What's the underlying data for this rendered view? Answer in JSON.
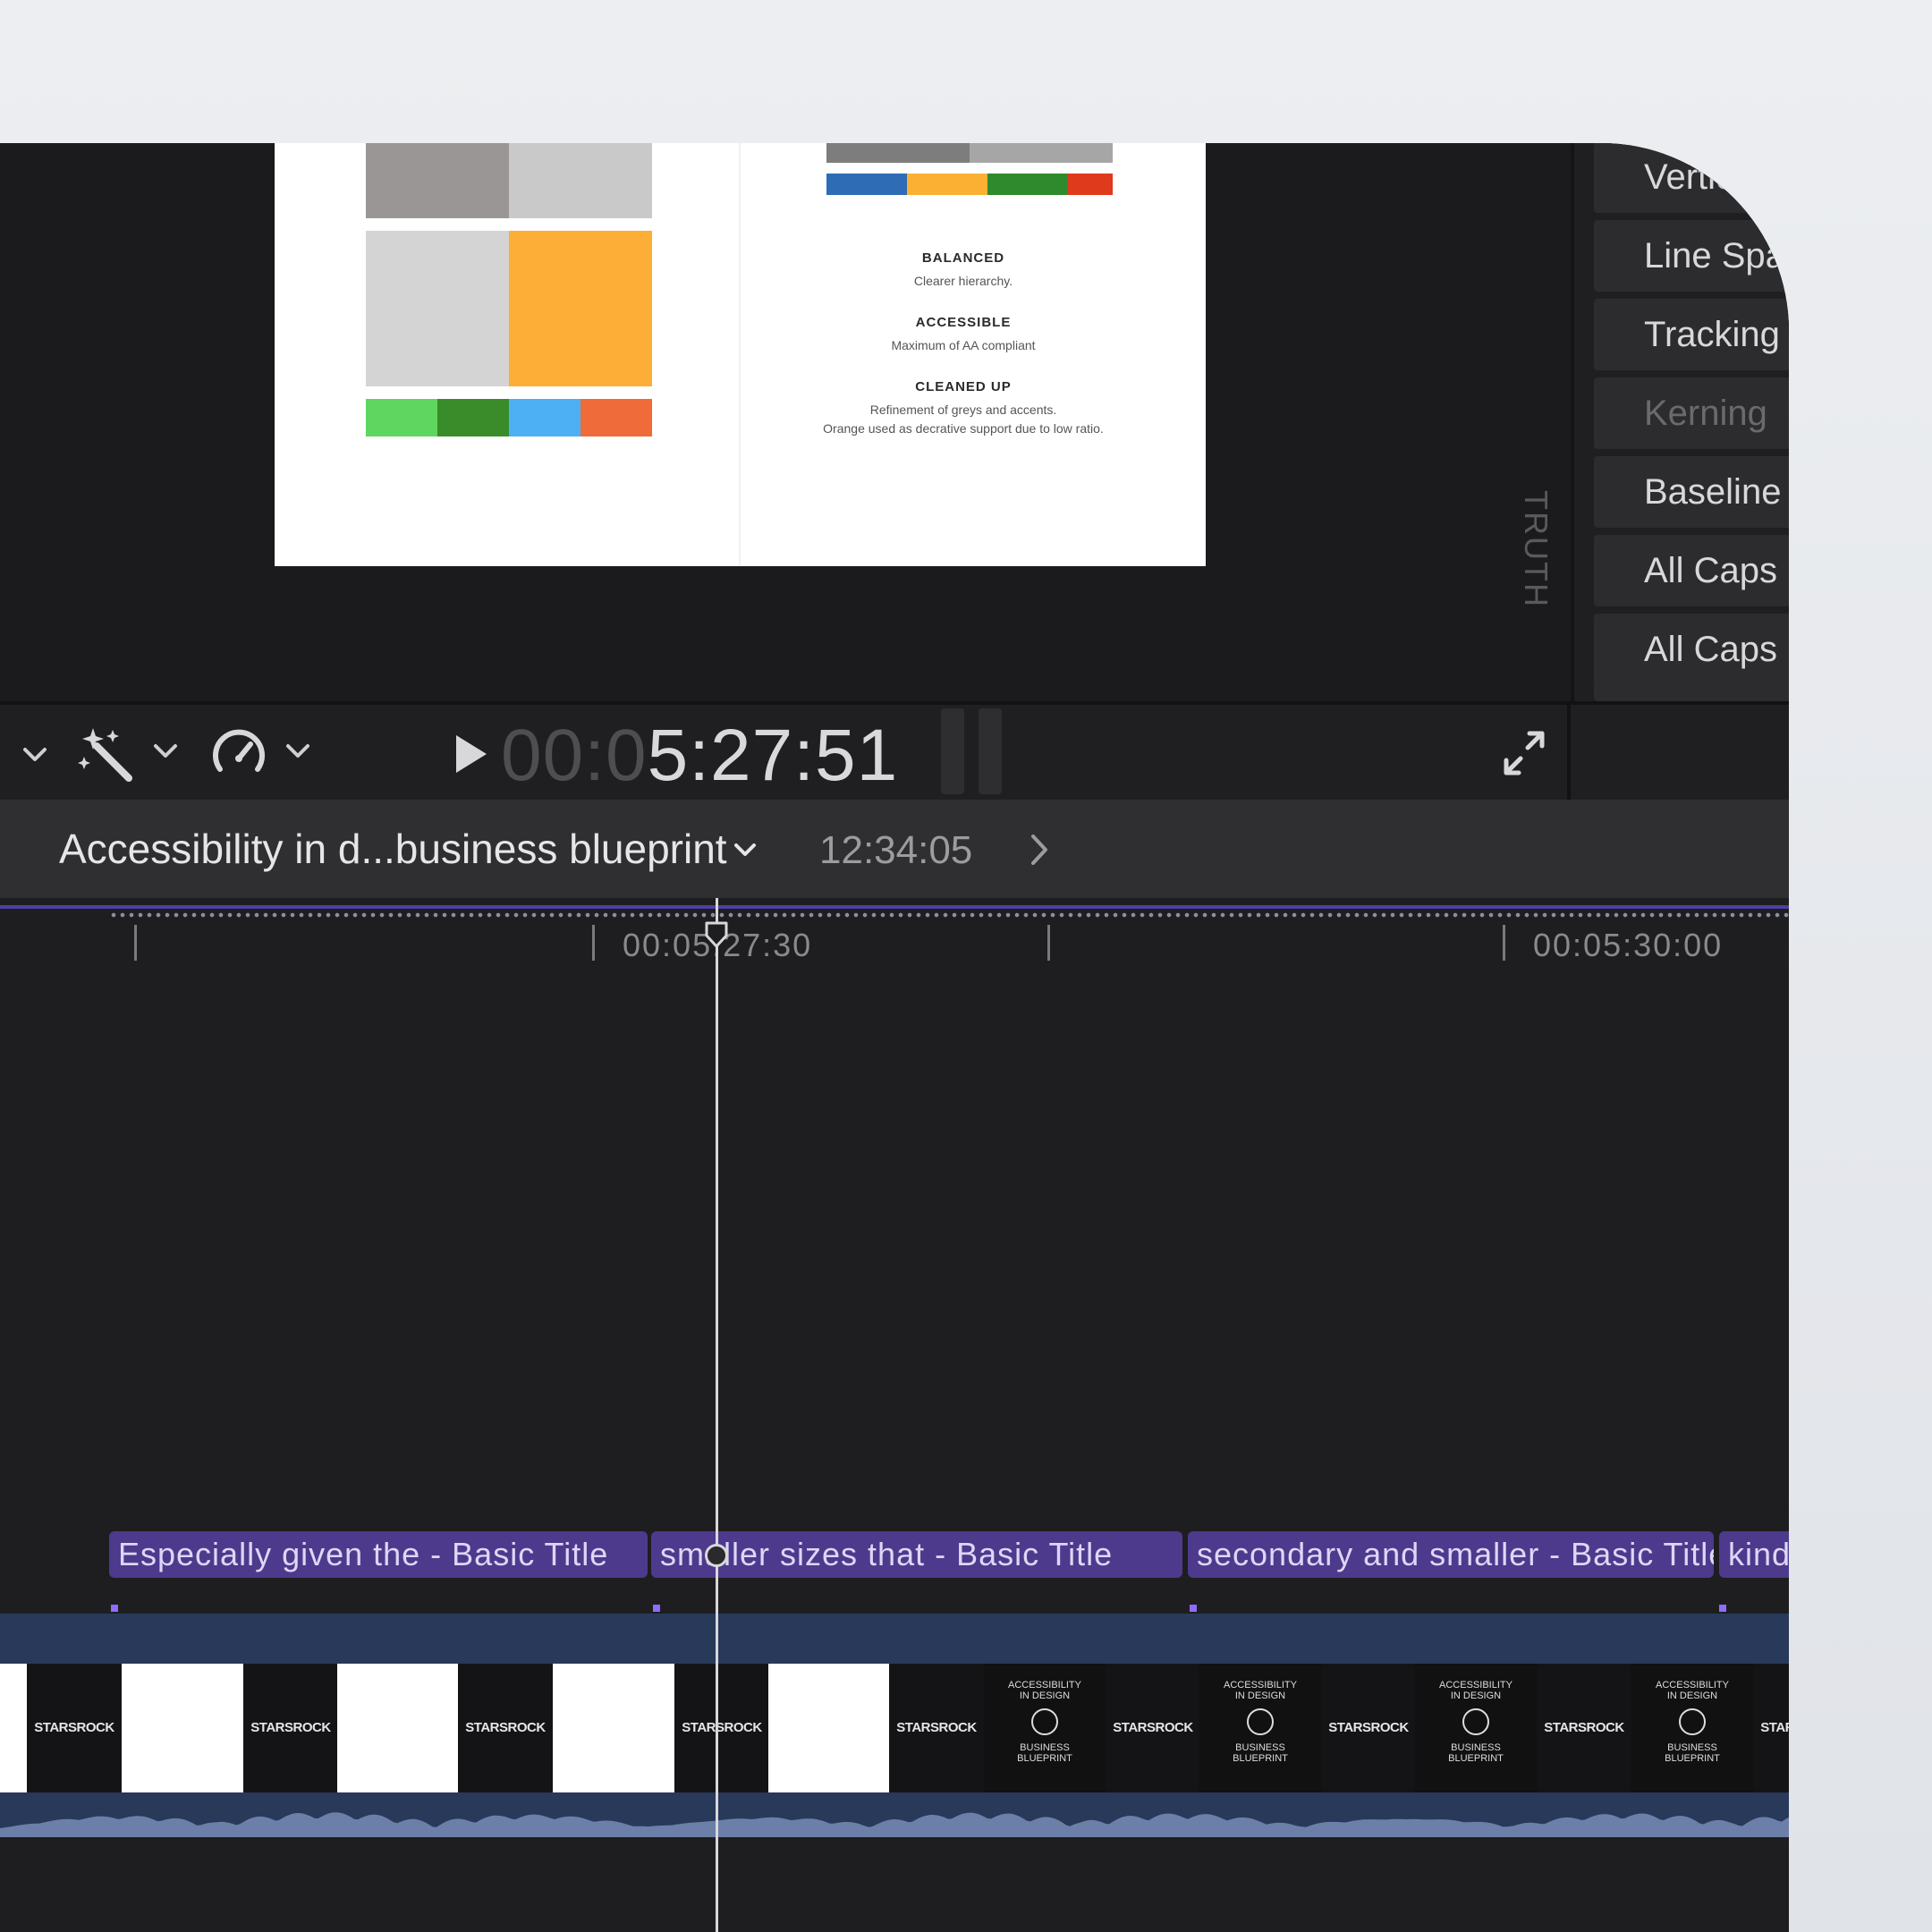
{
  "viewer": {
    "caption": [
      {
        "title": "BALANCED",
        "body": [
          "Clearer hierarchy."
        ]
      },
      {
        "title": "ACCESSIBLE",
        "body": [
          "Maximum of AA compliant"
        ]
      },
      {
        "title": "CLEANED UP",
        "body": [
          "Refinement of greys and accents.",
          "Orange used as decrative support due to low ratio."
        ]
      }
    ],
    "side_label": "TRUTH",
    "swatch_colors": {
      "gray_dark": "#9b9696",
      "gray_light": "#c9c9c9",
      "gray_lighter": "#d4d4d4",
      "orange": "#fdae37",
      "green_light": "#5ed660",
      "green_dark": "#3a8c2a",
      "blue_light": "#4eb0f4",
      "orange_red": "#ef6b3a",
      "top_gray_dark": "#7d7d7d",
      "top_gray": "#a6a6a6",
      "blue": "#2e6db5",
      "yellow": "#fbb034",
      "green": "#2f8a2e",
      "red": "#de3a1b"
    }
  },
  "inspector": {
    "items": [
      {
        "label": "Vertical",
        "dim": false
      },
      {
        "label": "Line Spacing",
        "dim": false
      },
      {
        "label": "Tracking",
        "dim": false
      },
      {
        "label": "Kerning",
        "dim": true
      },
      {
        "label": "Baseline",
        "dim": false
      },
      {
        "label": "All Caps",
        "dim": false
      },
      {
        "label": "All Caps Size",
        "dim": false
      }
    ]
  },
  "transport": {
    "timecode_dim": "00:0",
    "timecode": "5:27:51",
    "icons": [
      "chevron-down-icon",
      "magic-wand-icon",
      "chevron-down-icon",
      "speed-gauge-icon",
      "chevron-down-icon",
      "play-icon",
      "fullscreen-icon"
    ]
  },
  "timeline_header": {
    "project_name": "Accessibility in d...business blueprint",
    "duration": "12:34:05"
  },
  "timeline": {
    "ruler": [
      "00:05:27:30",
      "00:05:30:00"
    ],
    "title_clips": [
      "Especially given the - Basic Title",
      "smaller sizes that - Basic Title",
      "secondary and smaller - Basic Title",
      "kind"
    ],
    "thumbnail_brand": "STARSROCK",
    "thumbnail_title": [
      "ACCESSIBILITY",
      "IN DESIGN",
      "BUSINESS",
      "BLUEPRINT"
    ],
    "accent_color": "#4d3a8c",
    "track_color": "#28395a"
  }
}
